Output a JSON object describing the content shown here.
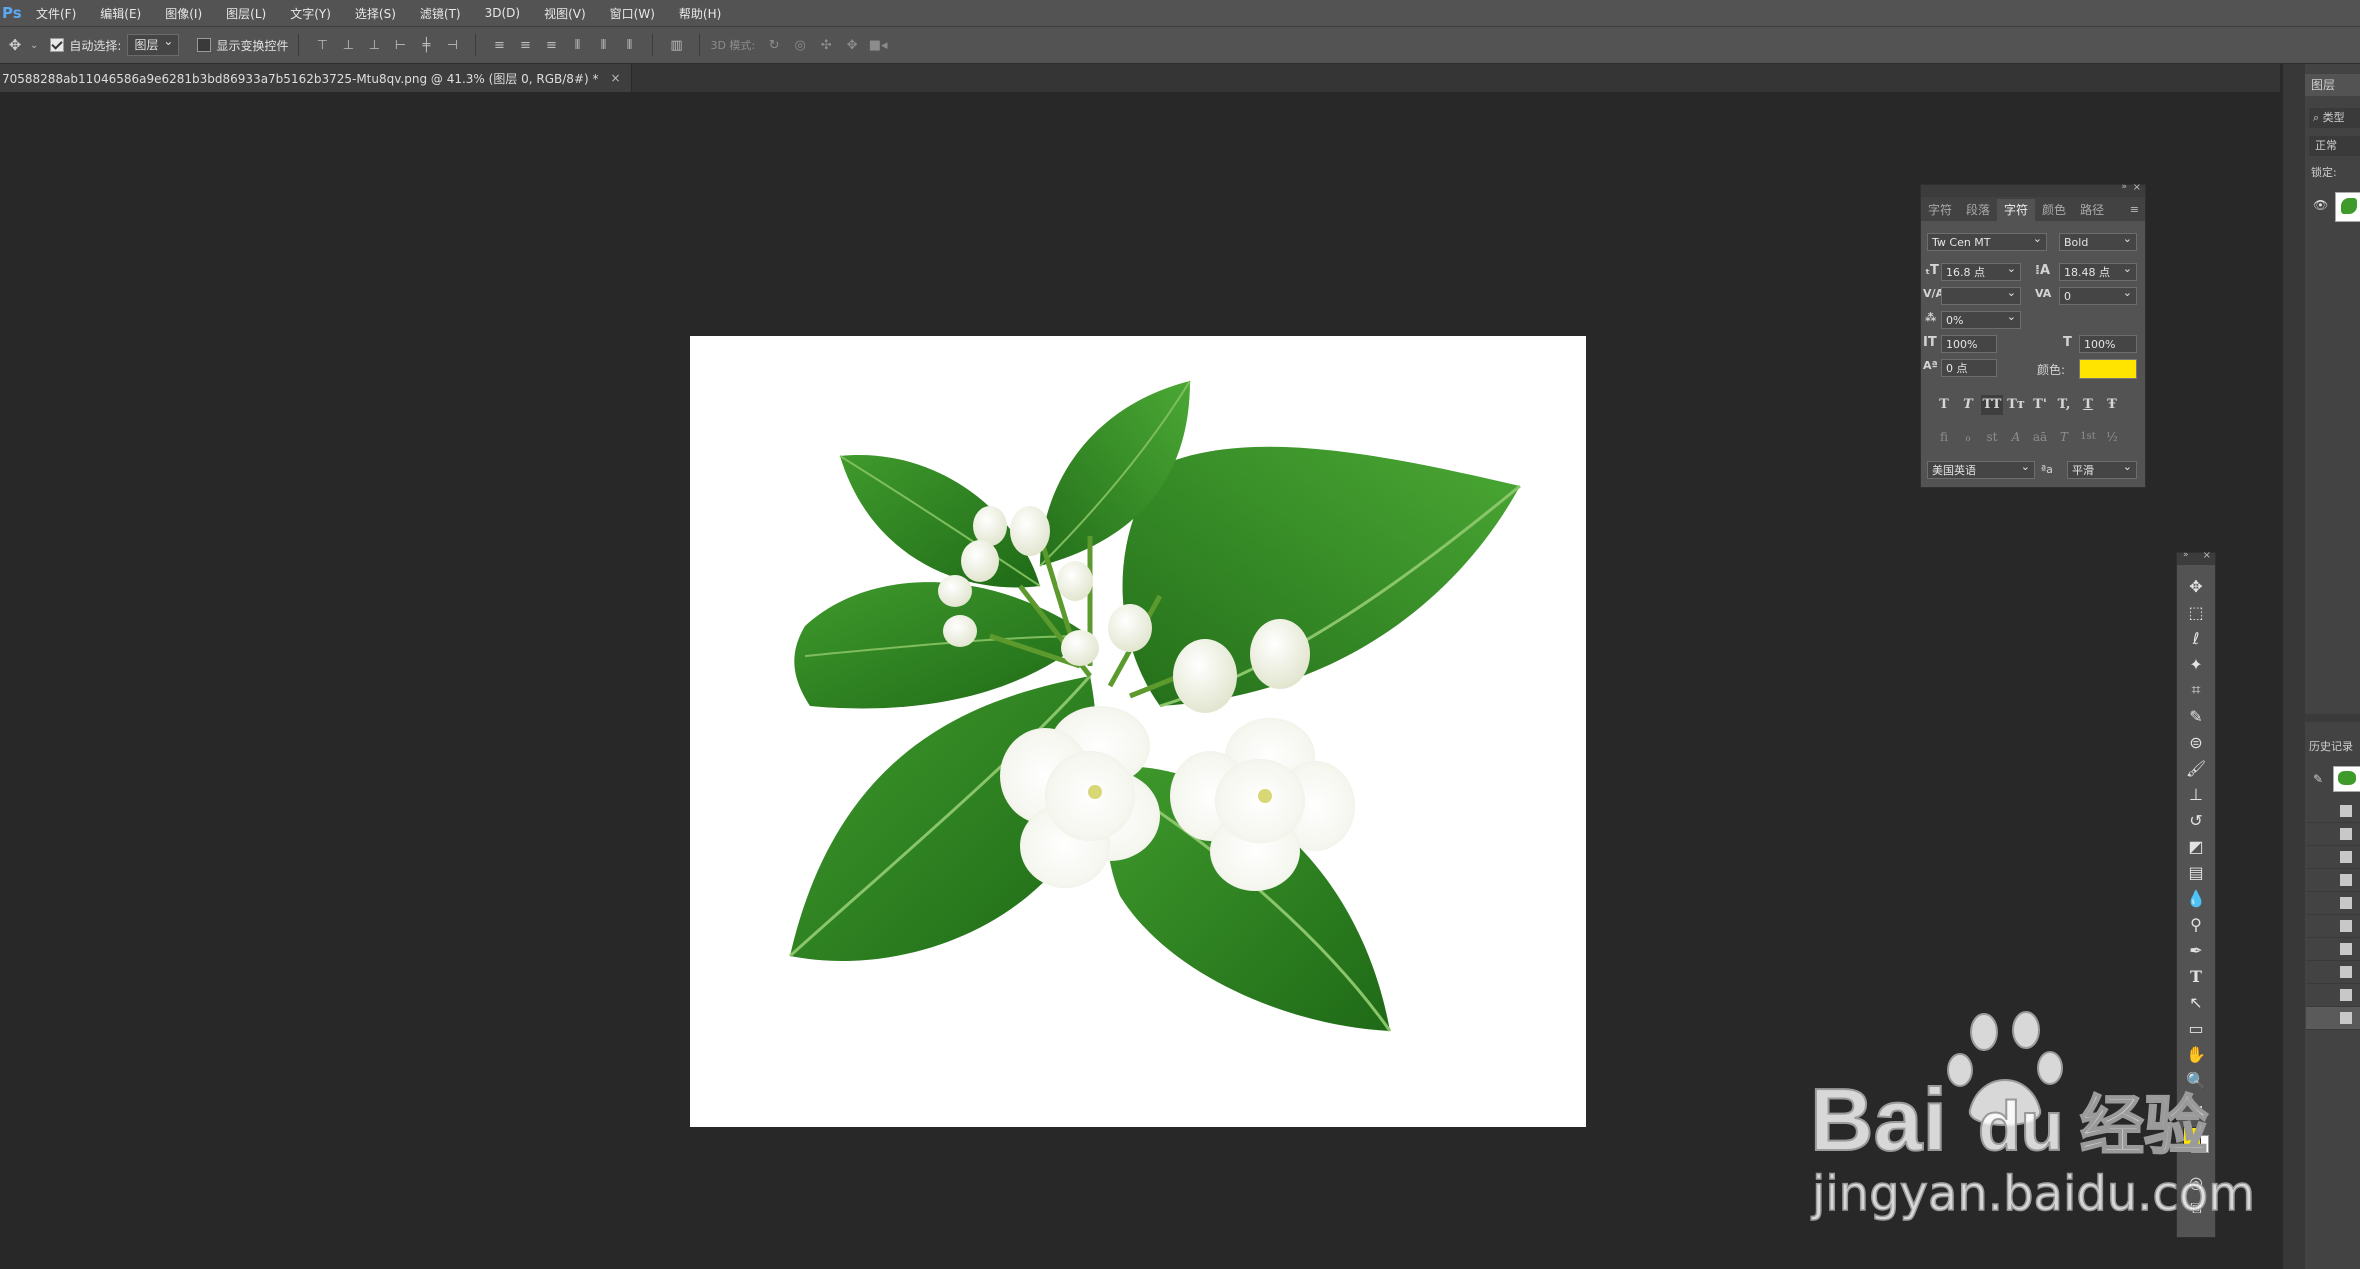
{
  "app": {
    "logo": "Ps"
  },
  "menu": [
    "文件(F)",
    "编辑(E)",
    "图像(I)",
    "图层(L)",
    "文字(Y)",
    "选择(S)",
    "滤镜(T)",
    "3D(D)",
    "视图(V)",
    "窗口(W)",
    "帮助(H)"
  ],
  "options_bar": {
    "auto_select_label": "自动选择:",
    "auto_select_checked": true,
    "auto_select_target": "图层",
    "show_transform_label": "显示变换控件",
    "show_transform_checked": false,
    "mode_3d_label": "3D 模式:"
  },
  "document_tab": {
    "title": "70588288ab11046586a9e6281b3bd86933a7b5162b3725-Mtu8qv.png @ 41.3% (图层 0, RGB/8#) *",
    "close": "×"
  },
  "character_panel": {
    "tabs": [
      "字符",
      "段落",
      "字符",
      "颜色",
      "路径"
    ],
    "active_tab_index": 2,
    "font_family": "Tw Cen MT",
    "font_style": "Bold",
    "font_size": "16.8 点",
    "leading": "18.48 点",
    "kerning": "",
    "tracking": "0",
    "scale_percent": "0%",
    "vertical_scale": "100%",
    "horizontal_scale": "100%",
    "baseline_shift": "0 点",
    "color_label": "颜色:",
    "color_value": "#ffe400",
    "type_buttons": [
      "T",
      "T",
      "TT",
      "Tт",
      "T'",
      "T,",
      "T",
      "Ŧ"
    ],
    "opentype_buttons": [
      "fi",
      "ℴ",
      "st",
      "A",
      "aā",
      "T",
      "1st",
      "½"
    ],
    "language": "美国英语",
    "aa_label": "ªa",
    "antialias": "平滑"
  },
  "layers_dock": {
    "layers_tab": "图层",
    "kind_filter": "类型",
    "blend_mode": "正常",
    "lock_label": "锁定:",
    "history_tab": "历史记录"
  },
  "tools": [
    "move-tool",
    "marquee-tool",
    "lasso-tool",
    "magic-wand-tool",
    "crop-tool",
    "eyedropper-tool",
    "healing-tool",
    "brush-tool",
    "stamp-tool",
    "history-brush-tool",
    "eraser-tool",
    "gradient-tool",
    "blur-tool",
    "dodge-tool",
    "pen-tool",
    "type-tool",
    "path-select-tool",
    "shape-tool",
    "hand-tool",
    "zoom-tool"
  ],
  "swatches": {
    "foreground": "#ffe400",
    "background": "#ffffff"
  },
  "watermark": {
    "brand": "Bai",
    "brand2": "du",
    "cn": "经验",
    "url": "jingyan.baidu.com"
  }
}
